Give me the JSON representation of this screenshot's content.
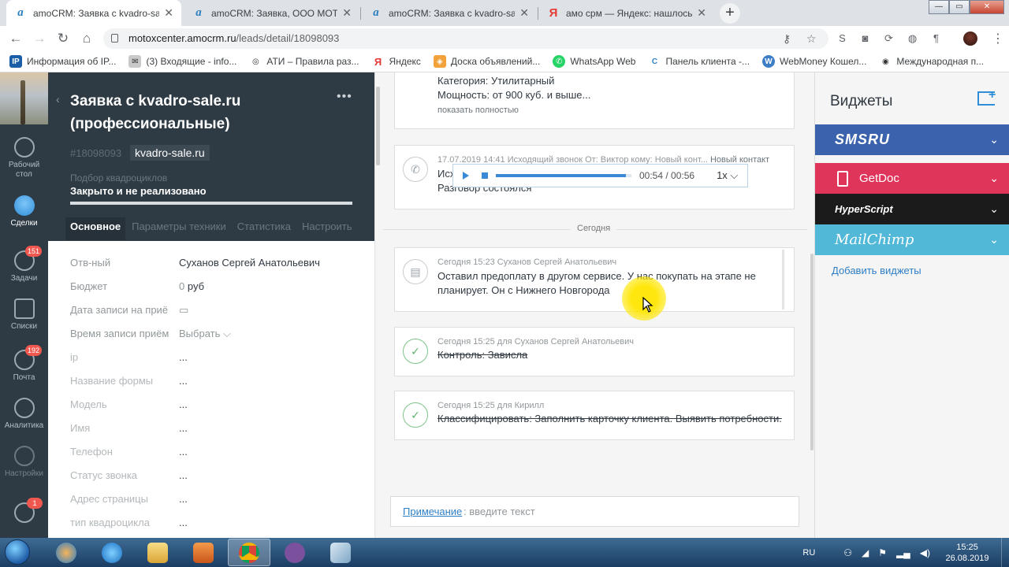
{
  "browser": {
    "tabs": [
      {
        "title": "amoCRM: Заявка с kvadro-sale.r",
        "favicon": "amocrm-icon",
        "active": true
      },
      {
        "title": "amoCRM: Заявка, ООО МОТОТ",
        "favicon": "amocrm-icon",
        "active": false
      },
      {
        "title": "amoCRM: Заявка с kvadro-sale.r",
        "favicon": "amocrm-icon",
        "active": false
      },
      {
        "title": "амо срм — Яндекс: нашлось 43",
        "favicon": "yandex-icon",
        "active": false
      }
    ],
    "url_host": "motoxcenter.amocrm.ru",
    "url_path": "/leads/detail/18098093",
    "bookmarks": [
      {
        "label": "Информация об IP...",
        "icon": "ip-icon"
      },
      {
        "label": "(3) Входящие - info...",
        "icon": "mail-icon"
      },
      {
        "label": "АТИ – Правила раз...",
        "icon": "ati-icon"
      },
      {
        "label": "Яндекс",
        "icon": "yandex-icon"
      },
      {
        "label": "Доска объявлений...",
        "icon": "board-icon"
      },
      {
        "label": "WhatsApp Web",
        "icon": "whatsapp-icon"
      },
      {
        "label": "Панель клиента -...",
        "icon": "panel-icon"
      },
      {
        "label": "WebMoney Кошел...",
        "icon": "webmoney-icon"
      },
      {
        "label": "Международная п...",
        "icon": "globe-icon"
      }
    ]
  },
  "nav": {
    "items": [
      {
        "label": "Рабочий стол",
        "icon": "dashboard-icon",
        "badge": ""
      },
      {
        "label": "Сделки",
        "icon": "deals-icon",
        "badge": ""
      },
      {
        "label": "Задачи",
        "icon": "tasks-icon",
        "badge": "151"
      },
      {
        "label": "Списки",
        "icon": "lists-icon",
        "badge": ""
      },
      {
        "label": "Почта",
        "icon": "mail-icon",
        "badge": "192"
      },
      {
        "label": "Аналитика",
        "icon": "analytics-icon",
        "badge": ""
      },
      {
        "label": "Настройки",
        "icon": "settings-icon",
        "badge": ""
      },
      {
        "label": "",
        "icon": "chat-icon",
        "badge": "1"
      }
    ]
  },
  "lead": {
    "title": "Заявка с kvadro-sale.ru (профессиональные)",
    "id": "#18098093",
    "tag": "kvadro-sale.ru",
    "pipeline": "Подбор квадроциклов",
    "status": "Закрыто и не реализовано",
    "progress": 1.0,
    "tabs": [
      "Основное",
      "Параметры техники",
      "Статистика",
      "Настроить"
    ],
    "fields": [
      {
        "label": "Отв-ный",
        "value": "Суханов Сергей Анатольевич"
      },
      {
        "label": "Бюджет",
        "value": "0",
        "unit": "руб"
      },
      {
        "label": "Дата записи на приё",
        "value": "▭"
      },
      {
        "label": "Время записи приём",
        "value": "Выбрать ⌵"
      },
      {
        "label": "ip",
        "value": "..."
      },
      {
        "label": "Название формы",
        "value": "..."
      },
      {
        "label": "Модель",
        "value": "..."
      },
      {
        "label": "Имя",
        "value": "..."
      },
      {
        "label": "Телефон",
        "value": "..."
      },
      {
        "label": "Статус звонка",
        "value": "..."
      },
      {
        "label": "Адрес страницы",
        "value": "..."
      },
      {
        "label": "тип квадроцикла",
        "value": "..."
      }
    ]
  },
  "feed": {
    "card1": {
      "line1": "Категория: Утилитарный",
      "line2": "Мощность: от 900 куб. и выше...",
      "more": "показать полностью"
    },
    "call": {
      "meta": "17.07.2019 14:41 Исходящий звонок От: Виктор кому: Новый конт...",
      "meta_link": "Новый контакт",
      "line1": "Исх",
      "line2": "Разговор состоялся",
      "player_time": "00:54 / 00:56",
      "player_progress": 0.96,
      "speed": "1x"
    },
    "divider": "Сегодня",
    "note": {
      "meta": "Сегодня 15:23 Суханов Сергей Анатольевич",
      "text": "Оставил предоплату в другом сервисе. У нас покупать на этапе не планирует. Он с Нижнего Новгорода"
    },
    "task1": {
      "meta": "Сегодня 15:25  для Суханов Сергей Анатольевич",
      "text": "Контроль: Зависла"
    },
    "task2": {
      "meta": "Сегодня 15:25  для Кирилл",
      "text": "Классифицировать: Заполнить карточку клиента. Выявить потребности."
    },
    "composer": {
      "link": "Примечание",
      "placeholder": ": введите текст"
    }
  },
  "widgets": {
    "title": "Виджеты",
    "items": [
      {
        "name": "SMSRU",
        "color": "#3b63ad"
      },
      {
        "name": "GetDoc",
        "color": "#e0355a"
      },
      {
        "name": "HyperScript",
        "color": "#1b1b1b"
      },
      {
        "name": "MailChimp",
        "color": "#52b8d8"
      }
    ],
    "add_link": "Добавить виджеты"
  },
  "taskbar": {
    "lang": "RU",
    "time": "15:25",
    "date": "26.08.2019"
  }
}
